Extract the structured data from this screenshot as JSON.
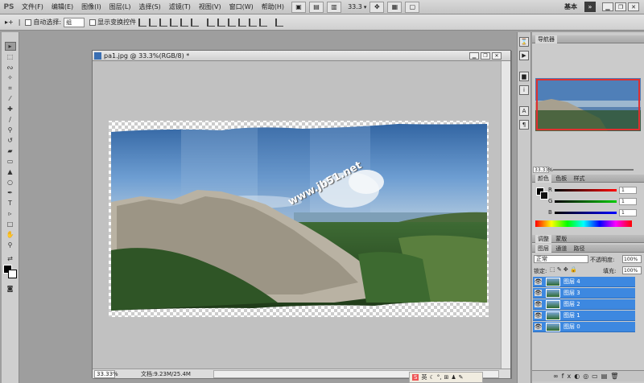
{
  "app": {
    "logo": "PS",
    "workspace": "基本",
    "workspace_arrow": "»"
  },
  "menu": [
    "文件(F)",
    "编辑(E)",
    "图像(I)",
    "图层(L)",
    "选择(S)",
    "滤镜(T)",
    "视图(V)",
    "窗口(W)",
    "帮助(H)"
  ],
  "menubar_tools": {
    "zoom": "33.3",
    "zoom_arrow": "▾"
  },
  "window_buttons": [
    "▁",
    "❐",
    "✕"
  ],
  "options": {
    "auto_select_label": "自动选择:",
    "auto_select_value": "组",
    "show_transform_label": "显示变换控件"
  },
  "document": {
    "title": "pa1.jpg @ 33.3%(RGB/8) *",
    "zoom": "33.33%",
    "info": "文档:9.23M/25.4M",
    "watermark": "www.jb51.net"
  },
  "panels": {
    "navigator_tab": "导航器",
    "navigator_zoom": "33.33%",
    "color_tabs": [
      "颜色",
      "色板",
      "样式"
    ],
    "color_channels": [
      {
        "label": "R",
        "value": "1"
      },
      {
        "label": "G",
        "value": "1"
      },
      {
        "label": "B",
        "value": "1"
      }
    ],
    "adjust_tabs": [
      "调整",
      "蒙版"
    ],
    "layer_tabs": [
      "图层",
      "通道",
      "路径"
    ],
    "blend_mode": "正常",
    "opacity_label": "不透明度:",
    "opacity_value": "100%",
    "lock_label": "锁定:",
    "fill_label": "填充:",
    "fill_value": "100%",
    "layers": [
      "图层 4",
      "图层 3",
      "图层 2",
      "图层 1",
      "图层 0"
    ]
  },
  "taskbar": [
    "英",
    "☾",
    "°,",
    "⊞",
    "♟",
    "✎"
  ],
  "colors": {
    "layer_selected": "#3d88e0",
    "nav_box": "#e03030"
  }
}
